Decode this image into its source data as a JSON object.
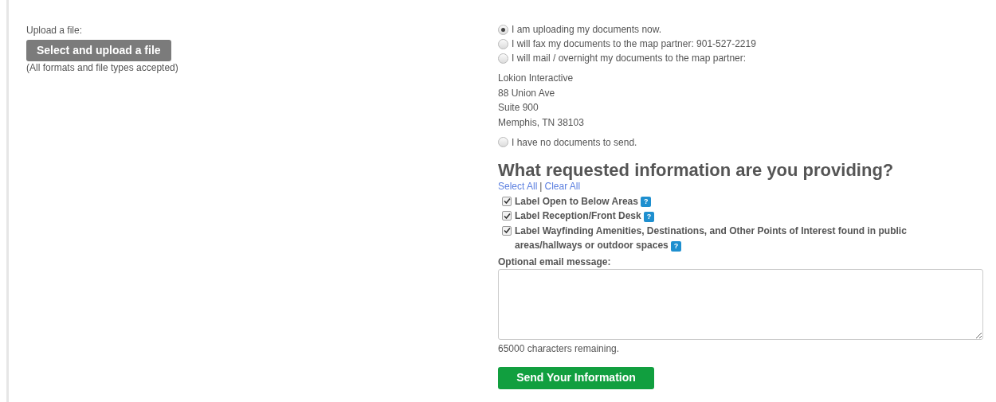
{
  "upload": {
    "label": "Upload a file:",
    "button": "Select and upload a file",
    "note": "(All formats and file types accepted)"
  },
  "delivery_options": [
    {
      "label": "I am uploading my documents now.",
      "selected": true
    },
    {
      "label": "I will fax my documents to the map partner: 901-527-2219",
      "selected": false
    },
    {
      "label": "I will mail / overnight my documents to the map partner:",
      "selected": false,
      "address": [
        "Lokion Interactive",
        "88 Union Ave",
        "Suite 900",
        "Memphis, TN 38103"
      ]
    },
    {
      "label": "I have no documents to send.",
      "selected": false
    }
  ],
  "heading": "What requested information are you providing?",
  "select_links": [
    "Select All",
    "Clear All"
  ],
  "select_separator": "|",
  "requested_items": [
    {
      "label": "Label Open to Below Areas",
      "checked": true,
      "help": "?"
    },
    {
      "label": "Label Reception/Front Desk",
      "checked": true,
      "help": "?"
    },
    {
      "label": "Label Wayfinding Amenities, Destinations, and Other Points of Interest found in public areas/hallways or outdoor spaces",
      "checked": true,
      "help": "?"
    }
  ],
  "message": {
    "label": "Optional email message:",
    "remaining": "65000 characters remaining."
  },
  "submit": "Send Your Information"
}
